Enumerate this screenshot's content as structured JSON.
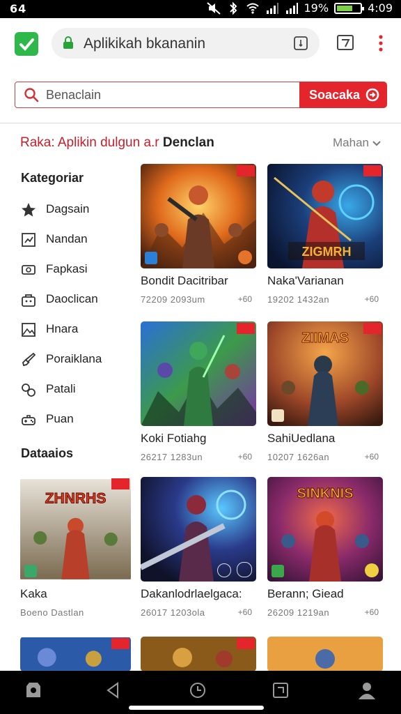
{
  "status": {
    "left": "64",
    "battery": "19%",
    "time": "4:09"
  },
  "browser": {
    "url": "Aplikikah bkananin"
  },
  "search": {
    "placeholder": "Benaclain",
    "button_label": "Soacaka"
  },
  "heading": {
    "prefix": "Raka: Aplikin dulgun a.r ",
    "bold": "Denclan",
    "more": "Mahan"
  },
  "sidebar": {
    "title": "Kategoriar",
    "items": [
      {
        "label": "Dagsain",
        "icon": "star-icon"
      },
      {
        "label": "Nandan",
        "icon": "chart-icon"
      },
      {
        "label": "Fapkasi",
        "icon": "cash-icon"
      },
      {
        "label": "Daoclican",
        "icon": "bag-icon"
      },
      {
        "label": "Hnara",
        "icon": "image-icon"
      },
      {
        "label": "Poraiklana",
        "icon": "brush-icon"
      },
      {
        "label": "Patali",
        "icon": "link-icon"
      },
      {
        "label": "Puan",
        "icon": "controller-icon"
      }
    ],
    "section2_title": "Dataaios"
  },
  "apps": [
    {
      "title": "Bondit Dacitribar",
      "meta": "72209  2093um",
      "meta2": "+60"
    },
    {
      "title": "Naka'Varianan",
      "meta": "19202  1432an",
      "meta2": "+60"
    },
    {
      "title": "Koki Fotiahg",
      "meta": "26217  1283un",
      "meta2": "+60"
    },
    {
      "title": "SahiUedlana",
      "meta": "10207  1626an",
      "meta2": "+60"
    },
    {
      "title": "Kaka",
      "meta": "Boeno Dastlan",
      "meta2": ""
    },
    {
      "title": "Dakanlodrlaelgaca:",
      "meta": "26017  1203ola",
      "meta2": "+60"
    },
    {
      "title": "Berann; Giead",
      "meta": "26209  1219an",
      "meta2": "+60"
    }
  ],
  "art_banner_text": {
    "app2": "ZIGMRH",
    "app4": "ZIIMAS",
    "app5": "ZHNRHS",
    "app7": "SINKNIS"
  },
  "colors": {
    "accent_red": "#e4252c",
    "brand_green": "#2eb84a"
  }
}
